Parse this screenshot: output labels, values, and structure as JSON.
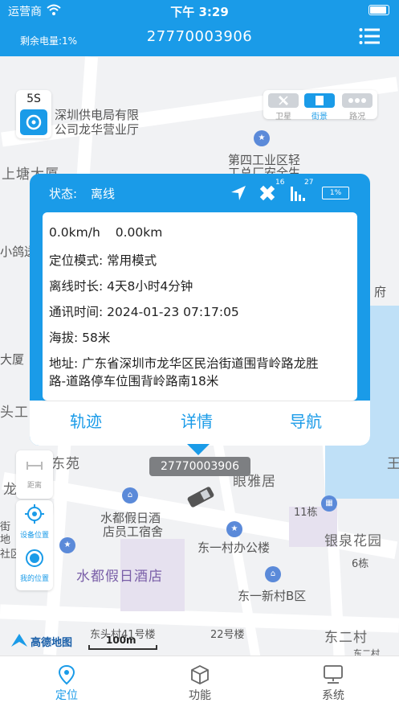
{
  "status_bar": {
    "carrier": "运营商",
    "time": "下午 3:29"
  },
  "header": {
    "battery_label": "剩余电量:1%",
    "device_id": "27770003906"
  },
  "map": {
    "refresh_interval": "5S",
    "layer_toggle": {
      "satellite": "卫星",
      "street": "街景",
      "traffic": "路况"
    },
    "labels": {
      "power_company_line1": "深圳供电局有限",
      "power_company_line2": "公司龙华营业厅",
      "fourth_industrial_line1": "第四工业区轻",
      "fourth_industrial_line2": "工总厂安全生",
      "shangtang": "上塘大厦",
      "xiaoge": "小鸽送",
      "tou": "头工",
      "da_sha": "大厦",
      "dong_yuan": "东苑",
      "long": "龙",
      "fu": "府",
      "wang": "王",
      "liang_ya_ju": "眼雅居",
      "shudu_staff_line1": "水都假日酒",
      "shudu_staff_line2": "店员工宿舍",
      "building_11": "11栋",
      "yinquan_garden": "银泉花园",
      "dongyicun_office": "东一村办公楼",
      "building_6": "6栋",
      "shudu_hotel": "水都假日酒店",
      "dongyi_xincun_b": "东一新村B区",
      "jie": "街",
      "di": "地",
      "zone": "社区",
      "dongtou_41": "东头村41号楼",
      "building_22": "22号楼",
      "dong_er_cun": "东二村",
      "dong_er_cun_partial": "东二村",
      "scale": "100m",
      "amap_logo": "高德地图"
    },
    "device_marker_label": "27770003906"
  },
  "popup": {
    "status_label": "状态:",
    "status_value": "离线",
    "satellite_count": "16",
    "signal_strength": "27",
    "battery_percent": "1%",
    "speed": "0.0km/h",
    "mileage": "0.00km",
    "mode_label": "定位模式:",
    "mode_value": "常用模式",
    "offline_label": "离线时长:",
    "offline_value": "4天8小时4分钟",
    "comm_label": "通讯时间:",
    "comm_value": "2024-01-23 07:17:05",
    "altitude_label": "海拔:",
    "altitude_value": "58米",
    "address_label": "地址:",
    "address_line1": "广东省深圳市龙华区民治街道围背岭路龙胜",
    "address_line2": "路-道路停车位围背岭路南18米",
    "actions": {
      "track": "轨迹",
      "details": "详情",
      "navigate": "导航"
    }
  },
  "side_tools": {
    "distance": "距离",
    "device_location": "设备位置",
    "my_location": "我的位置"
  },
  "tabs": [
    {
      "label": "定位",
      "icon": "location-pin-icon",
      "active": true
    },
    {
      "label": "功能",
      "icon": "cube-icon",
      "active": false
    },
    {
      "label": "系统",
      "icon": "monitor-icon",
      "active": false
    }
  ],
  "colors": {
    "primary": "#1a9be8",
    "map_bg": "#f1f2f4"
  }
}
